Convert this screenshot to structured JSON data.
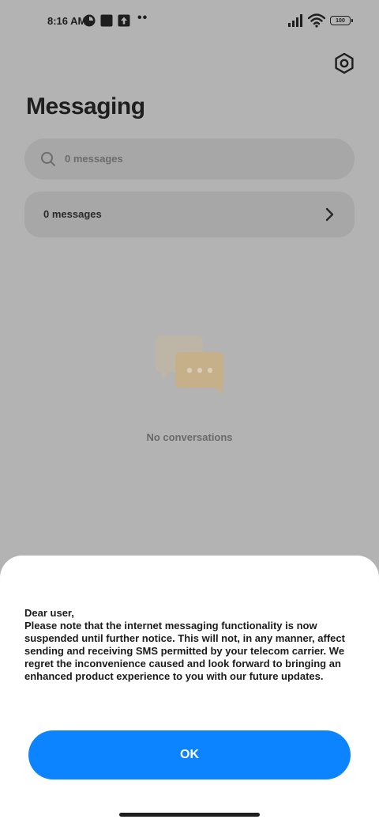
{
  "status_bar": {
    "time": "8:16 AM",
    "dots": "••",
    "battery": "100",
    "icons": [
      "app-notification-icon",
      "square-notification-icon",
      "upload-icon",
      "signal-icon",
      "wifi-icon",
      "battery-icon"
    ]
  },
  "header": {
    "title": "Messaging",
    "settings_icon": "settings-hexagon-icon"
  },
  "search": {
    "placeholder": "0 messages"
  },
  "messages_row": {
    "label": "0 messages"
  },
  "empty_state": {
    "text": "No conversations"
  },
  "dialog": {
    "greeting": "Dear user,",
    "body": "Please note that the internet messaging functionality is now suspended until further notice. This will not, in any manner, affect sending and receiving SMS permitted by your telecom carrier. We regret the inconvenience caused and look forward to bringing an enhanced product experience to you with our future updates.",
    "ok_label": "OK"
  },
  "colors": {
    "overlay_background": "#b3b3b3",
    "card_background": "#a7a7a7",
    "accent": "#0d84ff",
    "sheet_background": "#ffffff"
  }
}
